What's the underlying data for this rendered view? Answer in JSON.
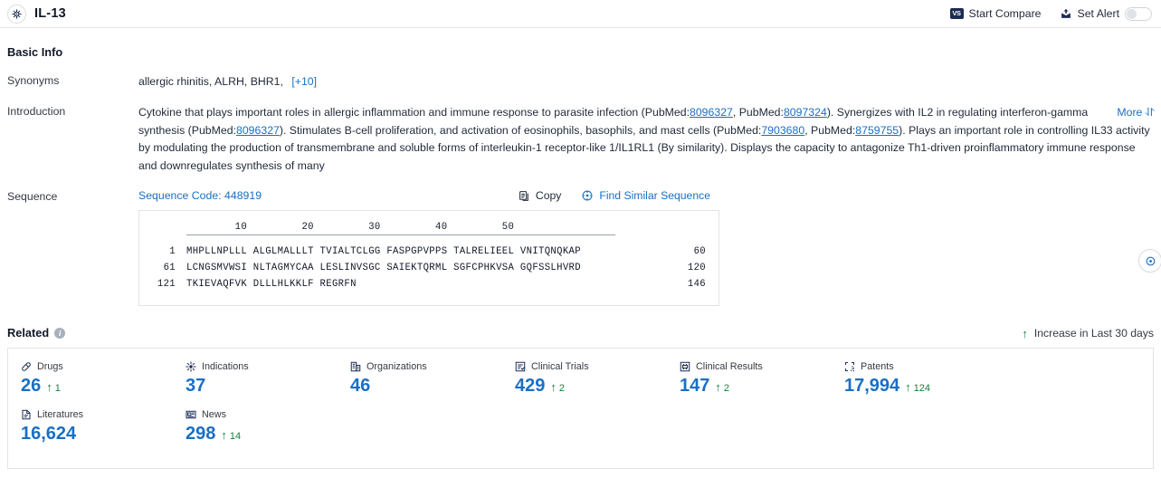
{
  "header": {
    "entity_name": "IL-13",
    "entity_icon": "target-icon",
    "start_compare": "Start Compare",
    "vs_label": "VS",
    "set_alert": "Set Alert",
    "alert_toggle_state": "off"
  },
  "basic_info": {
    "title": "Basic Info",
    "synonyms": {
      "label": "Synonyms",
      "values": "allergic rhinitis,  ALRH,  BHR1,",
      "more_count": "[+10]"
    },
    "introduction": {
      "label": "Introduction",
      "more_label": "More",
      "parts": [
        {
          "t": "Cytokine that plays important roles in allergic inflammation and immune response to parasite infection (PubMed:"
        },
        {
          "t": "8096327",
          "link": true
        },
        {
          "t": ", PubMed:"
        },
        {
          "t": "8097324",
          "link": true
        },
        {
          "t": "). Synergizes with IL2 in regulating interferon-gamma synthesis (PubMed:"
        },
        {
          "t": "8096327",
          "link": true
        },
        {
          "t": "). Stimulates B-cell proliferation, and activation of eosinophils, basophils, and mast cells (PubMed:"
        },
        {
          "t": "7903680",
          "link": true
        },
        {
          "t": ", PubMed:"
        },
        {
          "t": "8759755",
          "link": true
        },
        {
          "t": "). Plays an important role in controlling IL33 activity by modulating the production of transmembrane and soluble forms of interleukin-1 receptor-like 1/IL1RL1 (By similarity). Displays the capacity to antagonize Th1-driven proinflammatory immune response and downregulates synthesis of many"
        }
      ]
    },
    "sequence": {
      "label": "Sequence",
      "code_label": "Sequence Code: 448919",
      "copy_label": "Copy",
      "copy_icon": "copy-icon",
      "find_similar_label": "Find Similar Sequence",
      "find_similar_icon": "find-similar-icon",
      "ruler": "        10         20         30         40         50",
      "rows": [
        {
          "start": "1",
          "letters": "MHPLLNPLLL ALGLMALLLT TVIALTCLGG FASPGPVPPS TALRELIEEL VNITQNQKAP",
          "end": "60"
        },
        {
          "start": "61",
          "letters": "LCNGSMVWSI NLTAGMYCAA LESLINVSGC SAIEKTQRML SGFCPHKVSA GQFSSLHVRD",
          "end": "120"
        },
        {
          "start": "121",
          "letters": "TKIEVAQFVK DLLLHLKKLF REGRFN",
          "end": "146"
        }
      ]
    }
  },
  "related": {
    "title": "Related",
    "info_icon": "info-icon",
    "increase_note": "Increase in Last 30 days",
    "increase_arrow": "arrow-up-icon",
    "metrics": [
      {
        "icon": "drugs-icon",
        "label": "Drugs",
        "value": "26",
        "delta": "1"
      },
      {
        "icon": "indications-icon",
        "label": "Indications",
        "value": "37",
        "delta": ""
      },
      {
        "icon": "organizations-icon",
        "label": "Organizations",
        "value": "46",
        "delta": ""
      },
      {
        "icon": "clinical-trials-icon",
        "label": "Clinical Trials",
        "value": "429",
        "delta": "2"
      },
      {
        "icon": "clinical-results-icon",
        "label": "Clinical Results",
        "value": "147",
        "delta": "2"
      },
      {
        "icon": "patents-icon",
        "label": "Patents",
        "value": "17,994",
        "delta": "124"
      },
      {
        "icon": "literatures-icon",
        "label": "Literatures",
        "value": "16,624",
        "delta": ""
      },
      {
        "icon": "news-icon",
        "label": "News",
        "value": "298",
        "delta": "14"
      }
    ]
  },
  "colors": {
    "accent_link": "#1a6fc4",
    "increase_green": "#14803c",
    "dark_navy": "#1b2b54",
    "border": "#e1e4e8"
  }
}
